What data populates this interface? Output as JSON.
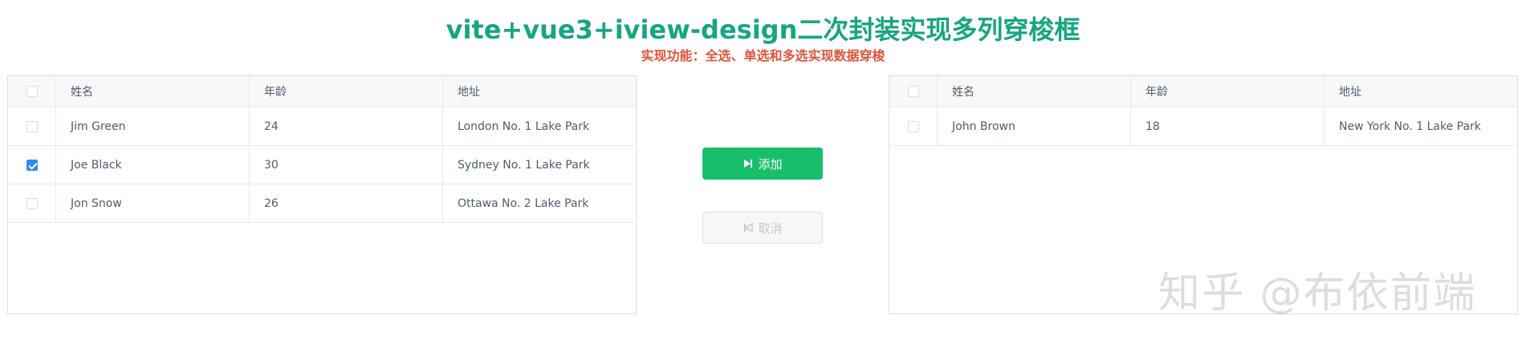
{
  "header": {
    "title": "vite+vue3+iview-design二次封装实现多列穿梭框",
    "subtitle": "实现功能：全选、单选和多选实现数据穿梭"
  },
  "columns": [
    "姓名",
    "年龄",
    "地址"
  ],
  "left_table": {
    "all_checked": false,
    "rows": [
      {
        "name": "Jim Green",
        "age": "24",
        "address": "London No. 1 Lake Park",
        "checked": false
      },
      {
        "name": "Joe Black",
        "age": "30",
        "address": "Sydney No. 1 Lake Park",
        "checked": true
      },
      {
        "name": "Jon Snow",
        "age": "26",
        "address": "Ottawa No. 2 Lake Park",
        "checked": false
      }
    ]
  },
  "right_table": {
    "all_checked": false,
    "rows": [
      {
        "name": "John Brown",
        "age": "18",
        "address": "New York No. 1 Lake Park",
        "checked": false
      }
    ]
  },
  "actions": {
    "add_label": "添加",
    "cancel_label": "取消"
  },
  "watermark": {
    "text": "知乎 @布依前端"
  },
  "colors": {
    "title": "#17a680",
    "subtitle": "#e0533a",
    "add_button": "#19be6b",
    "checkbox_checked": "#2d8cf0"
  },
  "icons": {
    "add": "step-forward-icon",
    "cancel": "step-backward-icon"
  }
}
